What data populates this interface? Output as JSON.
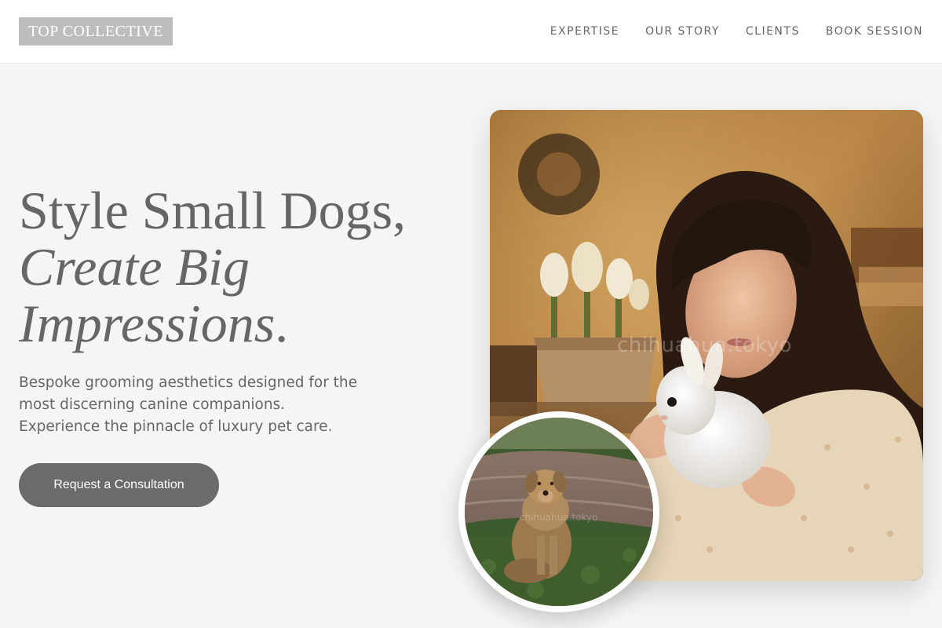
{
  "header": {
    "logo": "TOP COLLECTIVE",
    "nav": [
      "EXPERTISE",
      "OUR STORY",
      "CLIENTS",
      "BOOK SESSION"
    ]
  },
  "hero": {
    "headline_line1": "Style Small Dogs,",
    "headline_line2": "Create Big",
    "headline_line3_italic": "Impressions",
    "headline_line3_end": ".",
    "subtext": [
      "Bespoke grooming aesthetics designed for the",
      "most discerning canine companions.",
      "Experience the pinnacle of luxury pet care."
    ],
    "cta_label": "Request a Consultation"
  },
  "images": {
    "main_watermark": "chihuahua.tokyo",
    "circle_watermark": "chihuahua.tokyo"
  },
  "colors": {
    "background": "#f5f5f5",
    "text": "#666666",
    "button": "#6b6b6b",
    "logo_bg": "#bdbdbd"
  }
}
